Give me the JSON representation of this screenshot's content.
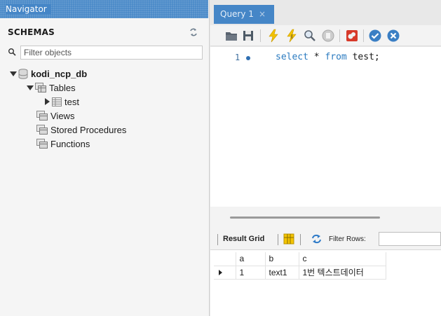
{
  "navigator": {
    "title": "Navigator",
    "schemas_label": "SCHEMAS",
    "filter_placeholder": "Filter objects",
    "tree": {
      "database": "kodi_ncp_db",
      "tables": "Tables",
      "table_test": "test",
      "views": "Views",
      "stored_procedures": "Stored Procedures",
      "functions": "Functions"
    }
  },
  "editor": {
    "tab_label": "Query 1",
    "tab_close": "×",
    "line_number": "1",
    "code": {
      "kw_select": "select",
      "star": " * ",
      "kw_from": "from",
      "rest": " test;"
    }
  },
  "result": {
    "result_grid_label": "Result Grid",
    "filter_rows_label": "Filter Rows:",
    "columns": [
      "a",
      "b",
      "c"
    ],
    "rows": [
      [
        "1",
        "text1",
        "1번 텍스트데이터"
      ]
    ]
  },
  "colors": {
    "accent": "#4586c7",
    "keyword": "#2b7bc0"
  },
  "icons": [
    "refresh-icon",
    "search-icon",
    "database-icon",
    "tables-folder-icon",
    "table-icon",
    "open-folder-icon",
    "save-icon",
    "execute-icon",
    "execute-current-icon",
    "explain-icon",
    "stop-icon",
    "toggle-continue-icon",
    "commit-icon",
    "rollback-icon",
    "grid-layout-icon",
    "refresh-result-icon"
  ]
}
